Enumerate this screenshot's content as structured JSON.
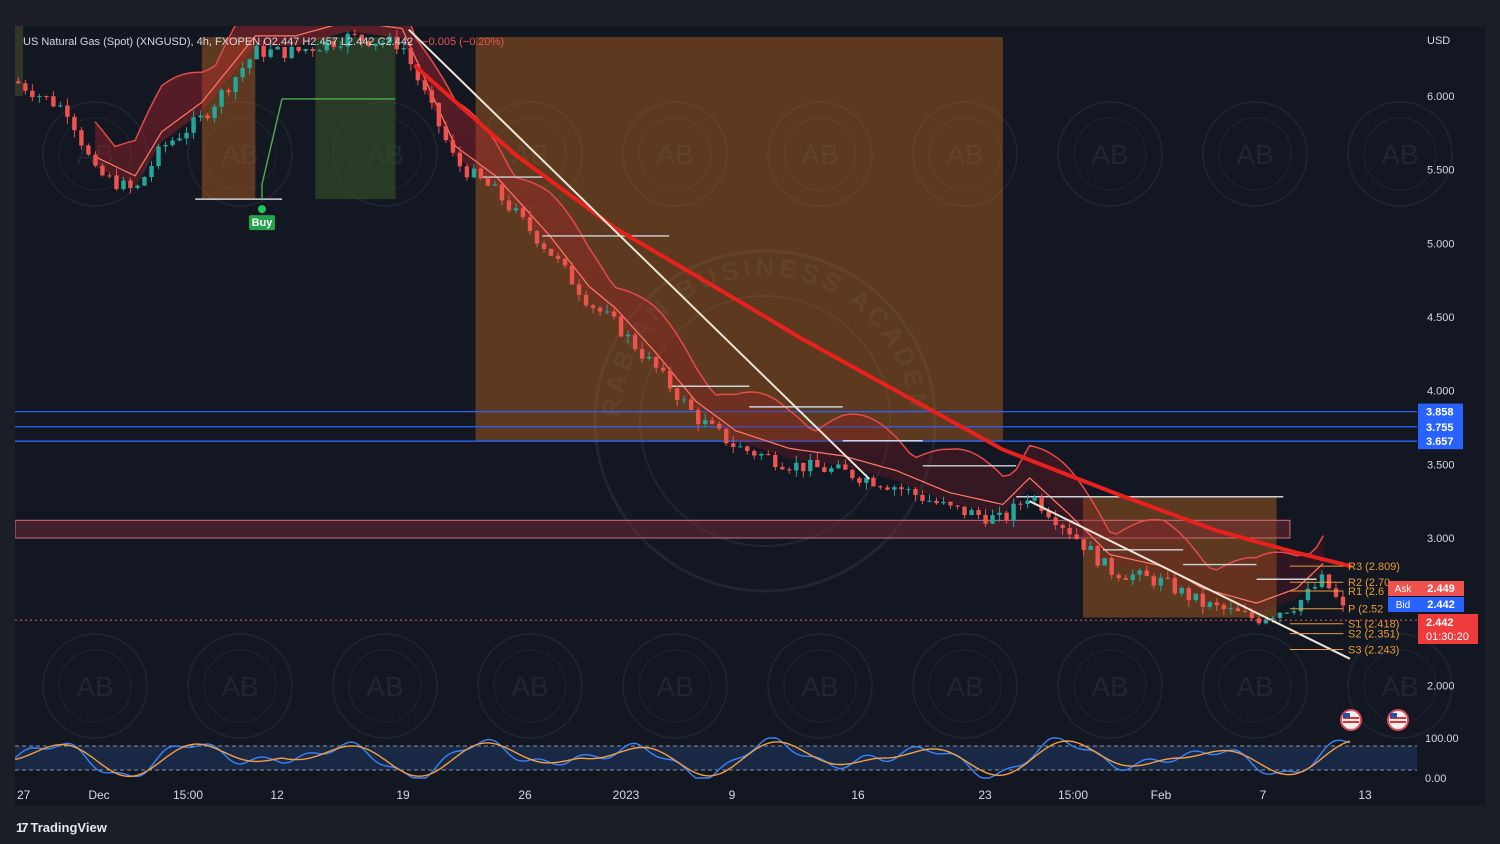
{
  "header": {
    "symbol_line": "US Natural Gas (Spot) (XNGUSD), 4h, FXOPEN  O2.447  H2.457  L2.442  C2.442",
    "change": "−0.005 (−0.20%)"
  },
  "price_axis": {
    "currency": "USD",
    "ticks": [
      "6.000",
      "5.500",
      "5.000",
      "4.500",
      "4.000",
      "3.500",
      "3.000",
      "2.000"
    ]
  },
  "osc_axis": {
    "ticks": [
      "100.00",
      "0.00"
    ]
  },
  "time_axis": {
    "labels": [
      "27",
      "Dec",
      "15:00",
      "12",
      "19",
      "26",
      "2023",
      "9",
      "16",
      "23",
      "15:00",
      "Feb",
      "7",
      "13"
    ]
  },
  "horizontal_levels": [
    "3.858",
    "3.755",
    "3.657"
  ],
  "pivots": [
    {
      "label": "R3 (2.809)",
      "value": 2.809
    },
    {
      "label": "R2 (2.70",
      "value": 2.7
    },
    {
      "label": "R1 (2.6",
      "value": 2.64
    },
    {
      "label": "P (2.52",
      "value": 2.52
    },
    {
      "label": "S1 (2.418)",
      "value": 2.418
    },
    {
      "label": "S2 (2.351)",
      "value": 2.351
    },
    {
      "label": "S3 (2.243)",
      "value": 2.243
    }
  ],
  "quote": {
    "ask_label": "Ask",
    "ask": "2.449",
    "bid_label": "Bid",
    "bid": "2.442",
    "last": "2.442",
    "countdown": "01:30:20"
  },
  "signal": {
    "label": "Buy"
  },
  "branding": {
    "name": "TradingView",
    "mark": "17"
  },
  "watermark": {
    "badge": "AB",
    "ring_text": "ARABIAN BUSINESS ACADEMY"
  },
  "colors": {
    "background": "#131722",
    "up": "#26a69a",
    "down": "#ef5350",
    "ema": "#e8211f",
    "levels": "#2962ff",
    "pivots": "#e89a3c",
    "trendline": "#f0e6d8",
    "shading": "#b8651c"
  },
  "chart_data": {
    "type": "candlestick",
    "symbol": "XNGUSD",
    "timeframe": "4h",
    "ylim": [
      1.9,
      6.4
    ],
    "x_range": [
      0,
      200
    ],
    "close_path": [
      [
        0,
        6.1
      ],
      [
        8,
        5.9
      ],
      [
        12,
        5.48
      ],
      [
        18,
        5.35
      ],
      [
        22,
        5.65
      ],
      [
        28,
        5.85
      ],
      [
        36,
        6.3
      ],
      [
        42,
        6.3
      ],
      [
        50,
        6.4
      ],
      [
        58,
        6.35
      ],
      [
        62,
        5.95
      ],
      [
        66,
        5.55
      ],
      [
        72,
        5.35
      ],
      [
        80,
        4.95
      ],
      [
        86,
        4.6
      ],
      [
        90,
        4.45
      ],
      [
        96,
        4.15
      ],
      [
        102,
        3.82
      ],
      [
        108,
        3.62
      ],
      [
        116,
        3.5
      ],
      [
        124,
        3.45
      ],
      [
        132,
        3.35
      ],
      [
        140,
        3.2
      ],
      [
        148,
        3.12
      ],
      [
        152,
        3.3
      ],
      [
        158,
        3.05
      ],
      [
        164,
        2.78
      ],
      [
        172,
        2.7
      ],
      [
        178,
        2.55
      ],
      [
        186,
        2.45
      ],
      [
        192,
        2.55
      ],
      [
        196,
        2.72
      ],
      [
        200,
        2.44
      ]
    ],
    "ema_path": [
      [
        60,
        6.2
      ],
      [
        75,
        5.6
      ],
      [
        90,
        5.1
      ],
      [
        105,
        4.7
      ],
      [
        118,
        4.35
      ],
      [
        132,
        4.0
      ],
      [
        148,
        3.6
      ],
      [
        165,
        3.3
      ],
      [
        180,
        3.05
      ],
      [
        192,
        2.9
      ],
      [
        200,
        2.81
      ]
    ],
    "trendlines": [
      {
        "from": [
          59,
          6.45
        ],
        "to": [
          128,
          3.4
        ]
      },
      {
        "from": [
          152,
          3.25
        ],
        "to": [
          200,
          2.18
        ]
      }
    ],
    "supertrend_segments": [
      {
        "x": [
          27,
          40
        ],
        "y": 5.3
      },
      {
        "x": [
          40,
          57
        ],
        "y": 5.98
      },
      {
        "x": [
          70,
          79
        ],
        "y": 5.45
      },
      {
        "x": [
          79,
          98
        ],
        "y": 5.05
      },
      {
        "x": [
          98,
          110
        ],
        "y": 4.03
      },
      {
        "x": [
          110,
          124
        ],
        "y": 3.89
      },
      {
        "x": [
          124,
          136
        ],
        "y": 3.66
      },
      {
        "x": [
          136,
          150
        ],
        "y": 3.49
      },
      {
        "x": [
          150,
          190
        ],
        "y": 3.28
      },
      {
        "x": [
          163,
          175
        ],
        "y": 2.92
      },
      {
        "x": [
          175,
          186
        ],
        "y": 2.82
      },
      {
        "x": [
          186,
          195
        ],
        "y": 2.72
      }
    ],
    "shaded_zones": [
      {
        "x": [
          28,
          36
        ],
        "y": [
          5.3,
          6.4
        ],
        "kind": "short"
      },
      {
        "x": [
          69,
          148
        ],
        "y": [
          3.66,
          6.4
        ],
        "kind": "short"
      },
      {
        "x": [
          160,
          189
        ],
        "y": [
          2.46,
          3.28
        ],
        "kind": "short"
      },
      {
        "x": [
          45,
          57
        ],
        "y": [
          5.3,
          6.4
        ],
        "kind": "long"
      }
    ],
    "support_zone": [
      3.0,
      3.12
    ],
    "horizontal_lines": [
      3.858,
      3.755,
      3.657
    ],
    "current_price": 2.442,
    "buy_signal": {
      "x": 37,
      "y": 5.3
    },
    "oscillator": {
      "ylim": [
        0,
        100
      ],
      "upper": 80,
      "lower": 20
    }
  }
}
